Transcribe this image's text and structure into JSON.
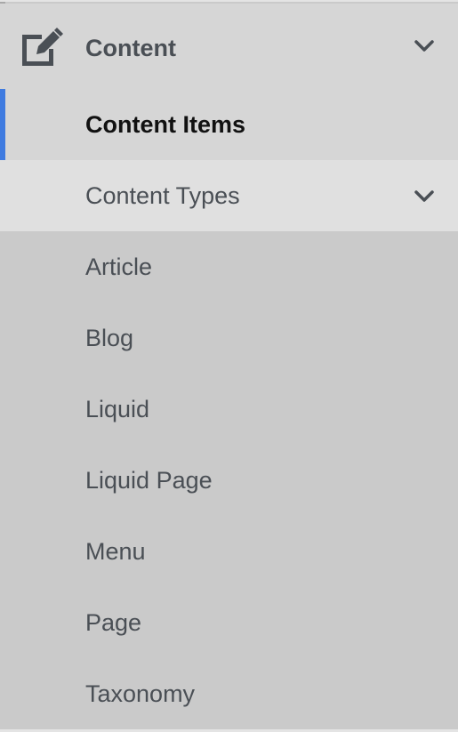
{
  "menu": {
    "header": {
      "label": "Content",
      "icon": "edit-icon",
      "expanded": true
    },
    "active_item": {
      "label": "Content Items"
    },
    "content_types": {
      "label": "Content Types",
      "expanded": true,
      "items": [
        {
          "label": "Article"
        },
        {
          "label": "Blog"
        },
        {
          "label": "Liquid"
        },
        {
          "label": "Liquid Page"
        },
        {
          "label": "Menu"
        },
        {
          "label": "Page"
        },
        {
          "label": "Taxonomy"
        }
      ]
    },
    "colors": {
      "accent": "#3f7be0",
      "background": "#cacaca",
      "header_bg": "#d6d6d6",
      "hover_bg": "#e0e0e0",
      "text": "#4a4f55",
      "active_text": "#111111"
    }
  }
}
